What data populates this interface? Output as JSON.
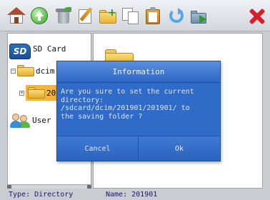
{
  "toolbar": {
    "icons": [
      "home-icon",
      "up-icon",
      "recycle-bin-icon",
      "edit-icon",
      "new-folder-icon",
      "copy-icon",
      "paste-icon",
      "refresh-icon",
      "move-icon",
      "close-icon"
    ]
  },
  "tree": {
    "sdcard_label": "SD Card",
    "sdcard_badge": "SD",
    "dcim_label": "dcim",
    "child_label": "20",
    "users_label": "User"
  },
  "dialog": {
    "title": "Information",
    "message": "Are you sure to set the current\ndirectory:\n/sdcard/dcim/201901/201901/ to\nthe saving folder ?",
    "cancel_label": "Cancel",
    "ok_label": "Ok"
  },
  "status": {
    "type_text": "Type: Directory",
    "name_text": "Name: 201901"
  }
}
